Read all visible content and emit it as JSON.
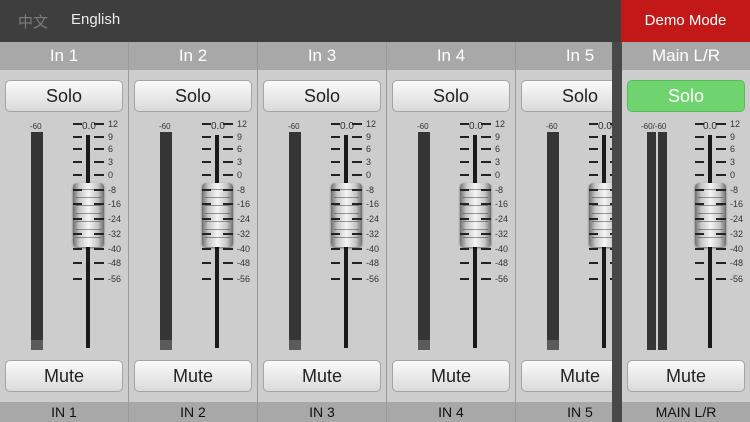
{
  "topbar": {
    "lang_zh": "中文",
    "lang_en": "English",
    "demo_mode": "Demo Mode"
  },
  "channels": [
    {
      "name": "In 1",
      "solo": "Solo",
      "mute": "Mute",
      "meter_label": "-60",
      "fader_value": "0.0",
      "footer": "IN 1"
    },
    {
      "name": "In 2",
      "solo": "Solo",
      "mute": "Mute",
      "meter_label": "-60",
      "fader_value": "0.0",
      "footer": "IN 2"
    },
    {
      "name": "In 3",
      "solo": "Solo",
      "mute": "Mute",
      "meter_label": "-60",
      "fader_value": "0.0",
      "footer": "IN 3"
    },
    {
      "name": "In 4",
      "solo": "Solo",
      "mute": "Mute",
      "meter_label": "-60",
      "fader_value": "0.0",
      "footer": "IN 4"
    },
    {
      "name": "In 5",
      "solo": "Solo",
      "mute": "Mute",
      "meter_label": "-60",
      "fader_value": "0.0",
      "footer": "IN 5"
    }
  ],
  "main": {
    "name": "Main L/R",
    "solo": "Solo",
    "mute": "Mute",
    "meter_label": "-60/-60",
    "fader_value": "0.0",
    "footer": "MAIN L/R",
    "solo_color": "#6fd46f"
  },
  "fader_scale": [
    "12",
    "9",
    "6",
    "3",
    "0",
    "-8",
    "-16",
    "-24",
    "-32",
    "-40",
    "-48",
    "-56"
  ],
  "colors": {
    "demo_mode": "#c21818",
    "topbar": "#3e3e3e",
    "solo_active": "#6fd46f"
  }
}
